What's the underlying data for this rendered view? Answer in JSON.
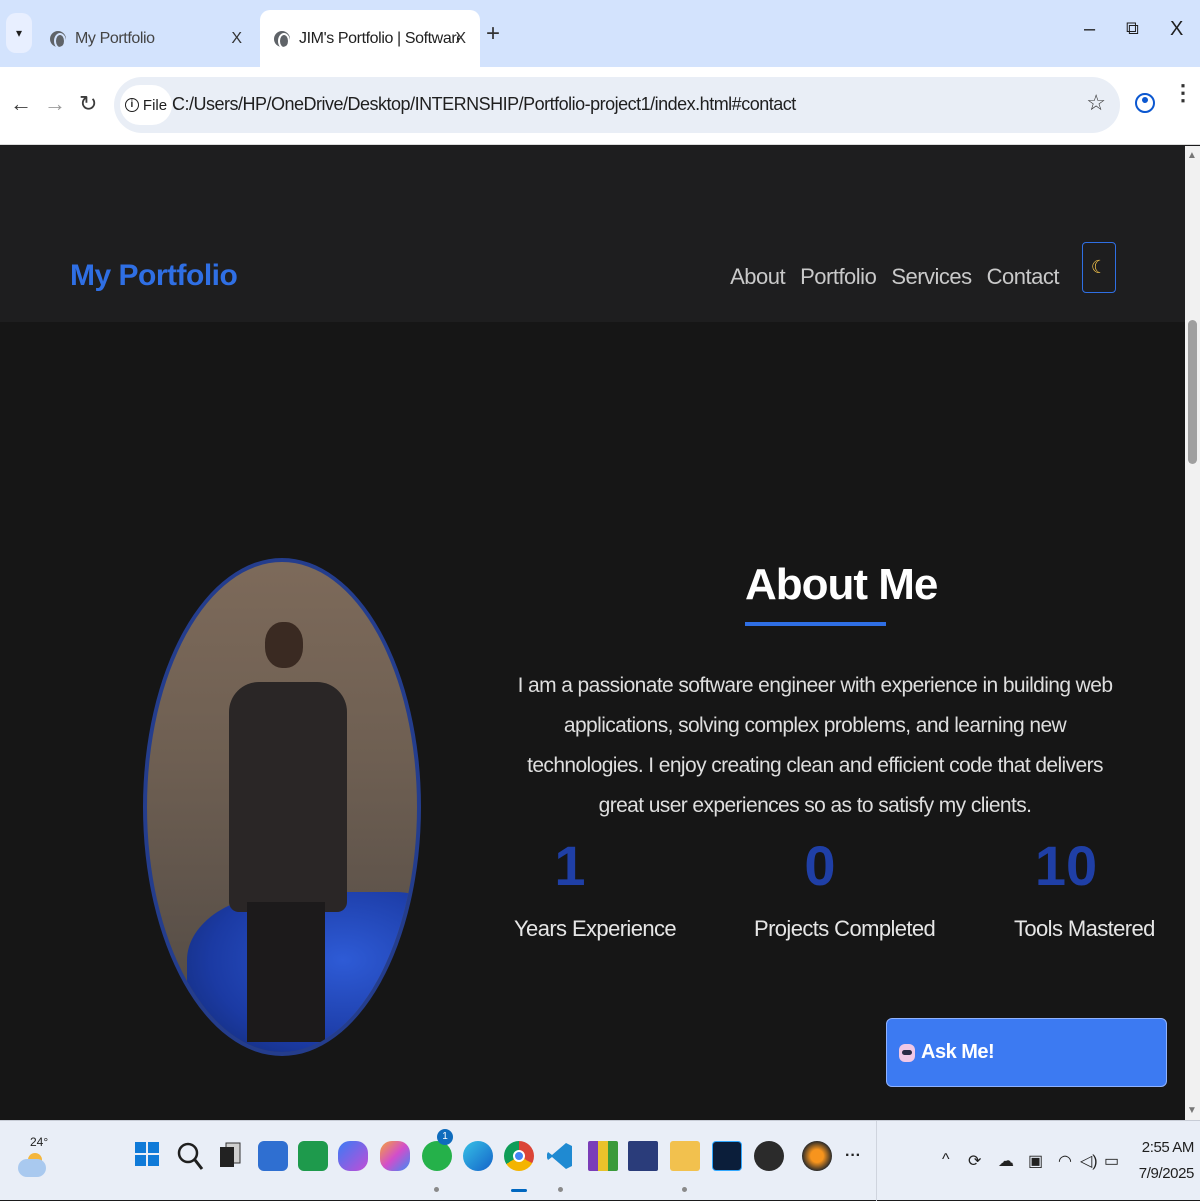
{
  "browser": {
    "tabs": [
      {
        "title": "My Portfolio",
        "active": false
      },
      {
        "title": "JIM's Portfolio | Software Engineer",
        "active": true
      }
    ],
    "new_tab_symbol": "+",
    "tab_close_symbol": "X",
    "window_controls": {
      "minimize": "–",
      "restore": "⧉",
      "close": "X"
    },
    "nav": {
      "back": "←",
      "forward": "→",
      "reload": "↻"
    },
    "site_chip": {
      "info": "i",
      "label": "File"
    },
    "url": "C:/Users/HP/OneDrive/Desktop/INTERNSHIP/Portfolio-project1/index.html#contact",
    "bookmark_symbol": "☆",
    "menu_symbol": "⋮"
  },
  "site": {
    "brand": "My Portfolio",
    "nav_links": [
      "About",
      "Portfolio",
      "Services",
      "Contact"
    ],
    "theme_toggle_icon": "☾",
    "about": {
      "title": "About Me",
      "text": "I am a passionate software engineer with experience in building web applications, solving complex problems, and learning new technologies. I enjoy creating clean and efficient code that delivers great user experiences so as to satisfy my clients.",
      "stats": [
        {
          "value": "1",
          "label": "Years Experience"
        },
        {
          "value": "0",
          "label": "Projects Completed"
        },
        {
          "value": "10",
          "label": "Tools Mastered"
        }
      ]
    },
    "ask_button": "Ask Me!"
  },
  "colors": {
    "accent": "#2f6fe4",
    "stat_number": "#1f3fa6",
    "page_bg": "#161616",
    "header_bg": "#1e1e1f",
    "ask_button_bg": "#3c7af2"
  },
  "taskbar": {
    "weather_temp": "24°",
    "apps": [
      "start-icon",
      "search-icon",
      "task-view-icon",
      "store-icon",
      "classroom-icon",
      "copilot-icon",
      "copilot-app-icon",
      "whatsapp-icon",
      "edge-icon",
      "chrome-icon",
      "vscode-icon",
      "winrar-icon",
      "devcpp-icon",
      "file-explorer-icon",
      "photoshop-icon",
      "obs-icon",
      "fl-studio-icon",
      "more-apps-icon"
    ],
    "whatsapp_badge": "1",
    "more_symbol": "···",
    "tray_chevron": "^",
    "time": "2:55 AM",
    "date": "7/9/2025"
  }
}
